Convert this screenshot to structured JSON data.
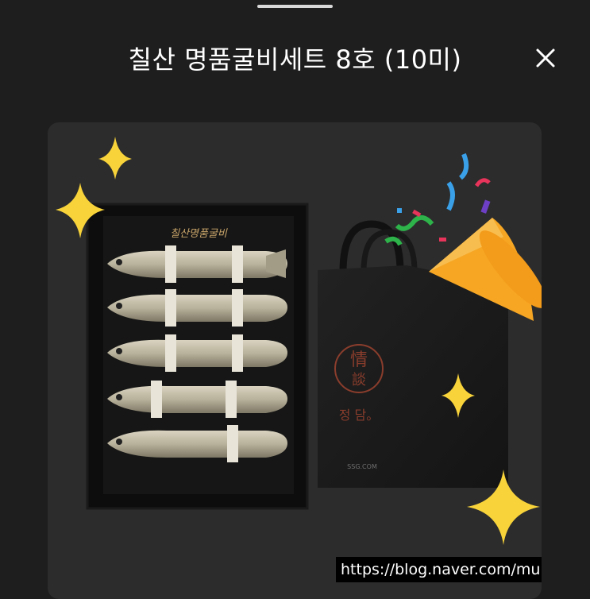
{
  "header": {
    "title": "칠산 명품굴비세트 8호 (10미)",
    "close_icon": "close-icon"
  },
  "product_image": {
    "box_brand_text": "칠산명품굴비",
    "bag_brand_text": "정 담。",
    "bag_sub_text": "SSG.COM",
    "fish_count_visible": 5
  },
  "overlay": {
    "watermark_text": "https://blog.naver.com/munjinaa"
  },
  "stickers": [
    "sparkle-icon",
    "party-popper-icon"
  ],
  "colors": {
    "background": "#1e1e1e",
    "card": "#2c2c2c",
    "sparkle": "#f8d33a"
  }
}
